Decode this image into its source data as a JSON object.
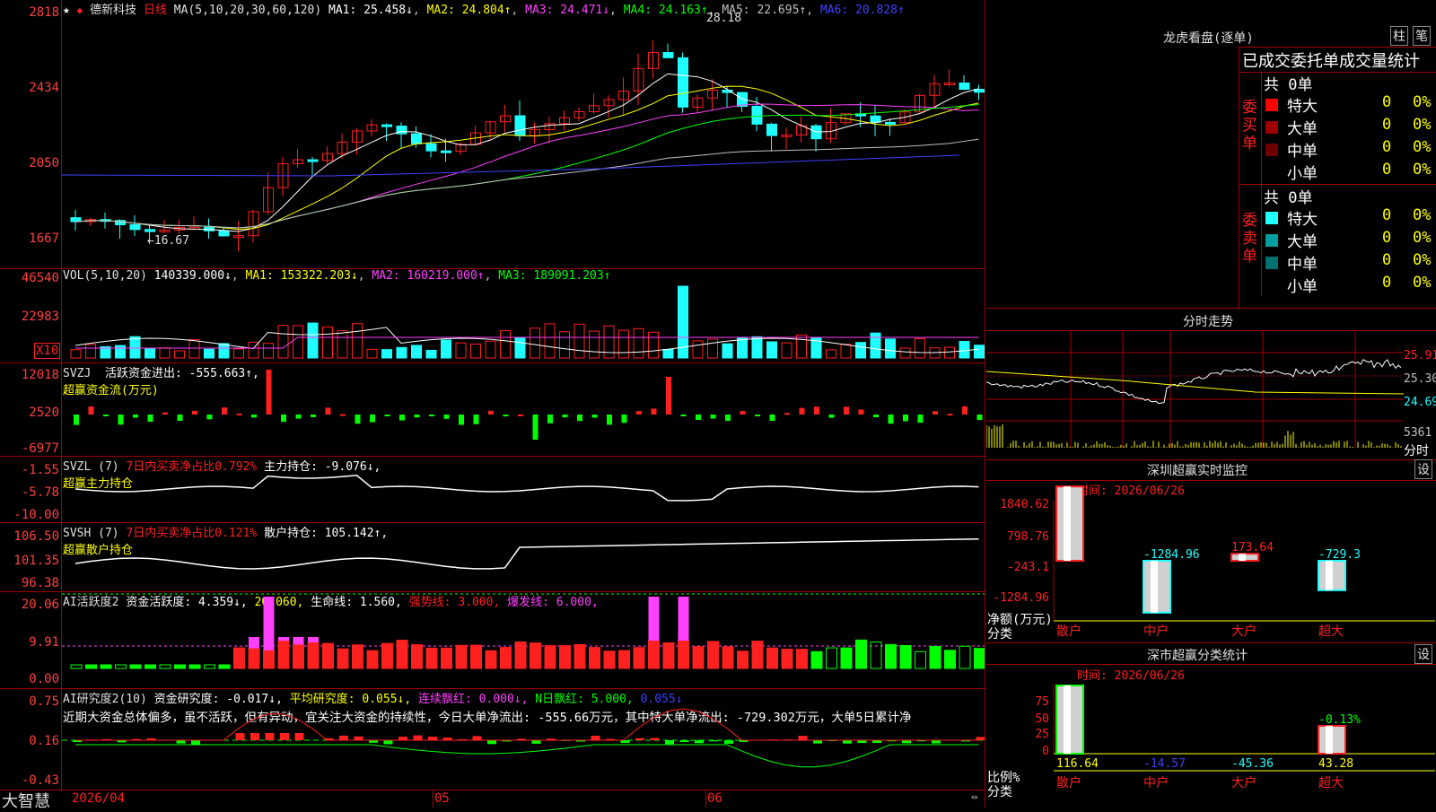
{
  "stock": {
    "name": "德新科技",
    "period": "日线"
  },
  "colors": {
    "up": "#ff2020",
    "down": "#20ffff",
    "ma1": "#ffffff",
    "ma2": "#ffff00",
    "ma3": "#ff40ff",
    "ma4": "#00ff00",
    "ma5": "#c0c0c0",
    "ma6": "#4040ff",
    "bg": "#000000",
    "border": "#a00000"
  },
  "main_panel": {
    "ma_header": {
      "label": "MA(5,10,20,30,60,120)",
      "ma1": "MA1: 25.458↓",
      "ma2": "MA2: 24.804↑",
      "ma3": "MA3: 24.471↓",
      "ma4": "MA4: 24.163↑",
      "ma5": "MA5: 22.695↑",
      "ma6": "MA6: 20.828↑"
    },
    "y_ticks": [
      "2818",
      "2434",
      "2050",
      "1667"
    ],
    "high_label": "28.18",
    "low_label": "16.67"
  },
  "vol_panel": {
    "header": {
      "label": "VOL(5,10,20)",
      "value": "140339.000↓",
      "ma1": "MA1: 153322.203↓",
      "ma2": "MA2: 160219.000↑",
      "ma3": "MA3: 189091.203↑"
    },
    "y_ticks": [
      "46540",
      "22983"
    ],
    "unit": "X10"
  },
  "svzj_panel": {
    "header": {
      "label": "SVZJ",
      "title": "活跃资金进出: -555.663↑,",
      "subtitle": "超赢资金流(万元)"
    },
    "y_ticks": [
      "12018",
      "2520",
      "-6977"
    ]
  },
  "svzl_panel": {
    "header": {
      "label": "SVZL (7)",
      "ratio": "7日内买卖净占比0.792%",
      "hold": "主力持仓: -9.076↓,",
      "subtitle": "超赢主力持仓"
    },
    "y_ticks": [
      "-1.55",
      "-5.78",
      "-10.00"
    ]
  },
  "svsh_panel": {
    "header": {
      "label": "SVSH (7)",
      "ratio": "7日内买卖净占比0.121%",
      "hold": "散户持仓: 105.142↑,",
      "subtitle": "超赢散户持仓"
    },
    "y_ticks": [
      "106.50",
      "101.35",
      "96.38"
    ]
  },
  "ai1_panel": {
    "header": {
      "label": "AI活跃度2",
      "a": "资金活跃度: 4.359↓,",
      "b": "20.060,",
      "c": "生命线: 1.560,",
      "d": "强势线: 3.000,",
      "e": "爆发线: 6.000,"
    },
    "y_ticks": [
      "20.06",
      "9.91",
      "0.00"
    ]
  },
  "ai2_panel": {
    "header": {
      "label": "AI研究度2(10)",
      "a": "资金研究度: -0.017↓,",
      "b": "平均研究度: 0.055↓,",
      "c": "连续飘红: 0.000↓,",
      "d": "N日飘红: 5.000,",
      "e": "0.055↓"
    },
    "text": "近期大资金总体偏多，虽不活跃，但有异动，宜关注大资金的持续性，今日大单净流出: -555.66万元，其中特大单净流出: -729.302万元，大单5日累计净",
    "y_ticks": [
      "0.75",
      "0.16",
      "-0.43"
    ]
  },
  "x_axis": {
    "labels": [
      "2026/04",
      "05",
      "06"
    ]
  },
  "footer": {
    "app_name": "大智慧"
  },
  "lhb": {
    "title": "龙虎看盘(逐单)",
    "btn1": "柱",
    "btn2": "笔",
    "header": "已成交委托单成交量统计",
    "buy": {
      "side": "委买单",
      "total": "共 0单",
      "rows": [
        {
          "label": "特大",
          "v": "0",
          "p": "0%",
          "c": "#ff0000"
        },
        {
          "label": "大单",
          "v": "0",
          "p": "0%",
          "c": "#a00000"
        },
        {
          "label": "中单",
          "v": "0",
          "p": "0%",
          "c": "#700000"
        },
        {
          "label": "小单",
          "v": "0",
          "p": "0%",
          "c": "#000000"
        }
      ]
    },
    "sell": {
      "side": "委卖单",
      "total": "共 0单",
      "rows": [
        {
          "label": "特大",
          "v": "0",
          "p": "0%",
          "c": "#20ffff"
        },
        {
          "label": "大单",
          "v": "0",
          "p": "0%",
          "c": "#00a0a0"
        },
        {
          "label": "中单",
          "v": "0",
          "p": "0%",
          "c": "#007070"
        },
        {
          "label": "小单",
          "v": "0",
          "p": "0%",
          "c": "#000000"
        }
      ]
    }
  },
  "intraday": {
    "title": "分时走势",
    "y_ticks": [
      "25.91",
      "25.30",
      "24.69"
    ],
    "vol_tick": "5361",
    "time_label": "分时"
  },
  "monitor": {
    "title": "深圳超赢实时监控",
    "btn": "设",
    "time": "时间: 2026/06/26",
    "y_ticks": [
      "1840.62",
      "798.76",
      "-243.1",
      "-1284.96"
    ],
    "unit_label": "净额(万元)",
    "cat_label": "分类",
    "bars": [
      {
        "label": "散户",
        "value": 1840.62,
        "text": "1840.62"
      },
      {
        "label": "中户",
        "value": -1284.96,
        "text": "-1284.96"
      },
      {
        "label": "大户",
        "value": 173.64,
        "text": "173.64"
      },
      {
        "label": "超大",
        "value": -729.3,
        "text": "-729.3"
      }
    ]
  },
  "classify": {
    "title": "深市超赢分类统计",
    "btn": "设",
    "time": "时间: 2026/06/26",
    "y_ticks": [
      "75",
      "50",
      "25",
      "0"
    ],
    "unit_label": "比例%",
    "cat_label": "分类",
    "bars": [
      {
        "label": "散户",
        "value": 116.64,
        "text": "116.64"
      },
      {
        "label": "中户",
        "value": -14.57,
        "text": "-14.57"
      },
      {
        "label": "大户",
        "value": -45.36,
        "text": "-45.36"
      },
      {
        "label": "超大",
        "value": 43.28,
        "text": "43.28",
        "pct": "-0.13%"
      }
    ]
  }
}
